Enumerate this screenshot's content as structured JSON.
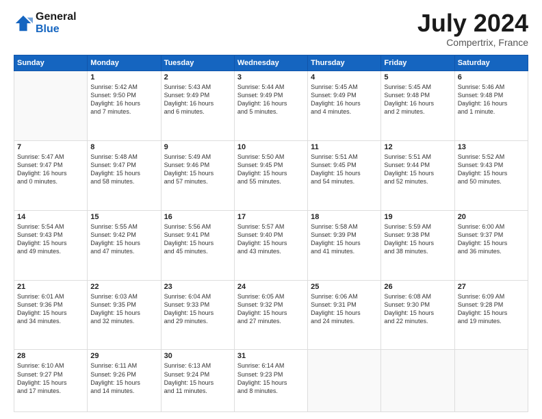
{
  "header": {
    "logo_general": "General",
    "logo_blue": "Blue",
    "month_title": "July 2024",
    "location": "Compertrix, France"
  },
  "days_of_week": [
    "Sunday",
    "Monday",
    "Tuesday",
    "Wednesday",
    "Thursday",
    "Friday",
    "Saturday"
  ],
  "weeks": [
    [
      {
        "day": "",
        "info": ""
      },
      {
        "day": "1",
        "info": "Sunrise: 5:42 AM\nSunset: 9:50 PM\nDaylight: 16 hours\nand 7 minutes."
      },
      {
        "day": "2",
        "info": "Sunrise: 5:43 AM\nSunset: 9:49 PM\nDaylight: 16 hours\nand 6 minutes."
      },
      {
        "day": "3",
        "info": "Sunrise: 5:44 AM\nSunset: 9:49 PM\nDaylight: 16 hours\nand 5 minutes."
      },
      {
        "day": "4",
        "info": "Sunrise: 5:45 AM\nSunset: 9:49 PM\nDaylight: 16 hours\nand 4 minutes."
      },
      {
        "day": "5",
        "info": "Sunrise: 5:45 AM\nSunset: 9:48 PM\nDaylight: 16 hours\nand 2 minutes."
      },
      {
        "day": "6",
        "info": "Sunrise: 5:46 AM\nSunset: 9:48 PM\nDaylight: 16 hours\nand 1 minute."
      }
    ],
    [
      {
        "day": "7",
        "info": "Sunrise: 5:47 AM\nSunset: 9:47 PM\nDaylight: 16 hours\nand 0 minutes."
      },
      {
        "day": "8",
        "info": "Sunrise: 5:48 AM\nSunset: 9:47 PM\nDaylight: 15 hours\nand 58 minutes."
      },
      {
        "day": "9",
        "info": "Sunrise: 5:49 AM\nSunset: 9:46 PM\nDaylight: 15 hours\nand 57 minutes."
      },
      {
        "day": "10",
        "info": "Sunrise: 5:50 AM\nSunset: 9:45 PM\nDaylight: 15 hours\nand 55 minutes."
      },
      {
        "day": "11",
        "info": "Sunrise: 5:51 AM\nSunset: 9:45 PM\nDaylight: 15 hours\nand 54 minutes."
      },
      {
        "day": "12",
        "info": "Sunrise: 5:51 AM\nSunset: 9:44 PM\nDaylight: 15 hours\nand 52 minutes."
      },
      {
        "day": "13",
        "info": "Sunrise: 5:52 AM\nSunset: 9:43 PM\nDaylight: 15 hours\nand 50 minutes."
      }
    ],
    [
      {
        "day": "14",
        "info": "Sunrise: 5:54 AM\nSunset: 9:43 PM\nDaylight: 15 hours\nand 49 minutes."
      },
      {
        "day": "15",
        "info": "Sunrise: 5:55 AM\nSunset: 9:42 PM\nDaylight: 15 hours\nand 47 minutes."
      },
      {
        "day": "16",
        "info": "Sunrise: 5:56 AM\nSunset: 9:41 PM\nDaylight: 15 hours\nand 45 minutes."
      },
      {
        "day": "17",
        "info": "Sunrise: 5:57 AM\nSunset: 9:40 PM\nDaylight: 15 hours\nand 43 minutes."
      },
      {
        "day": "18",
        "info": "Sunrise: 5:58 AM\nSunset: 9:39 PM\nDaylight: 15 hours\nand 41 minutes."
      },
      {
        "day": "19",
        "info": "Sunrise: 5:59 AM\nSunset: 9:38 PM\nDaylight: 15 hours\nand 38 minutes."
      },
      {
        "day": "20",
        "info": "Sunrise: 6:00 AM\nSunset: 9:37 PM\nDaylight: 15 hours\nand 36 minutes."
      }
    ],
    [
      {
        "day": "21",
        "info": "Sunrise: 6:01 AM\nSunset: 9:36 PM\nDaylight: 15 hours\nand 34 minutes."
      },
      {
        "day": "22",
        "info": "Sunrise: 6:03 AM\nSunset: 9:35 PM\nDaylight: 15 hours\nand 32 minutes."
      },
      {
        "day": "23",
        "info": "Sunrise: 6:04 AM\nSunset: 9:33 PM\nDaylight: 15 hours\nand 29 minutes."
      },
      {
        "day": "24",
        "info": "Sunrise: 6:05 AM\nSunset: 9:32 PM\nDaylight: 15 hours\nand 27 minutes."
      },
      {
        "day": "25",
        "info": "Sunrise: 6:06 AM\nSunset: 9:31 PM\nDaylight: 15 hours\nand 24 minutes."
      },
      {
        "day": "26",
        "info": "Sunrise: 6:08 AM\nSunset: 9:30 PM\nDaylight: 15 hours\nand 22 minutes."
      },
      {
        "day": "27",
        "info": "Sunrise: 6:09 AM\nSunset: 9:28 PM\nDaylight: 15 hours\nand 19 minutes."
      }
    ],
    [
      {
        "day": "28",
        "info": "Sunrise: 6:10 AM\nSunset: 9:27 PM\nDaylight: 15 hours\nand 17 minutes."
      },
      {
        "day": "29",
        "info": "Sunrise: 6:11 AM\nSunset: 9:26 PM\nDaylight: 15 hours\nand 14 minutes."
      },
      {
        "day": "30",
        "info": "Sunrise: 6:13 AM\nSunset: 9:24 PM\nDaylight: 15 hours\nand 11 minutes."
      },
      {
        "day": "31",
        "info": "Sunrise: 6:14 AM\nSunset: 9:23 PM\nDaylight: 15 hours\nand 8 minutes."
      },
      {
        "day": "",
        "info": ""
      },
      {
        "day": "",
        "info": ""
      },
      {
        "day": "",
        "info": ""
      }
    ]
  ]
}
